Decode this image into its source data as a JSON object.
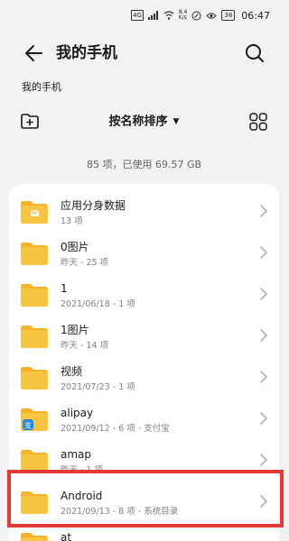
{
  "status_bar": {
    "sim1": "4G",
    "signal": "4G",
    "speed_value": "8.4",
    "speed_unit": "K/s",
    "battery": "38",
    "time": "06:47"
  },
  "header": {
    "title": "我的手机",
    "back_icon": "arrow-left-icon",
    "search_icon": "search-icon"
  },
  "breadcrumb": "我的手机",
  "toolbar": {
    "new_folder_icon": "new-folder-icon",
    "sort_label": "按名称排序",
    "view_icon": "grid-view-icon"
  },
  "summary": "85 项，已使用 69.57 GB",
  "colors": {
    "folder": "#f9c440",
    "folder_back": "#f4b324",
    "accent": "#1e88e5",
    "highlight": "#e53935"
  },
  "items": [
    {
      "name": "应用分身数据",
      "meta": "13 项",
      "badge": "envelope"
    },
    {
      "name": "0图片",
      "meta": "昨天 - 25 项",
      "badge": ""
    },
    {
      "name": "1",
      "meta": "2021/06/18 - 1 项",
      "badge": ""
    },
    {
      "name": "1图片",
      "meta": "昨天 - 14 项",
      "badge": ""
    },
    {
      "name": "视频",
      "meta": "2021/07/23 - 1 项",
      "badge": ""
    },
    {
      "name": "alipay",
      "meta": "2021/09/12 - 6 项 - 支付宝",
      "badge": "alipay"
    },
    {
      "name": "amap",
      "meta": "昨天 - 1 项",
      "badge": ""
    },
    {
      "name": "Android",
      "meta": "2021/09/13 - 8 项 - 系统目录",
      "badge": ""
    },
    {
      "name": "at",
      "meta": "",
      "badge": ""
    }
  ]
}
